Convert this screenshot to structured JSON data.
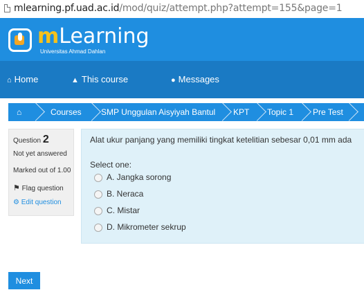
{
  "browser": {
    "url_host": "mlearning.pf.uad.ac.id",
    "url_path": "/mod/quiz/attempt.php?attempt=155&page=1"
  },
  "brand": {
    "logo_m": "m",
    "logo_rest": "Learning",
    "logo_sub": "Universitas Ahmad Dahlan"
  },
  "nav": {
    "home": "Home",
    "this_course": "This course",
    "messages": "Messages"
  },
  "breadcrumb": [
    "Courses",
    "SMP Unggulan Aisyiyah Bantul",
    "KPT",
    "Topic 1",
    "Pre Test"
  ],
  "info": {
    "question_label": "Question",
    "question_number": "2",
    "status": "Not yet answered",
    "marked_out_of": "Marked out of 1.00",
    "flag": "Flag question",
    "edit": "Edit question"
  },
  "question": {
    "text": "Alat ukur panjang yang memiliki tingkat ketelitian sebesar 0,01 mm ada",
    "prompt": "Select one:",
    "options": [
      "A. Jangka sorong",
      "B. Neraca",
      "C. Mistar",
      "D. Mikrometer sekrup"
    ]
  },
  "next_label": "Next",
  "colors": {
    "header_blue": "#1f8ee0",
    "nav_blue": "#1a7ac4",
    "question_bg": "#dff1f9",
    "logo_accent": "#f5c11a"
  }
}
